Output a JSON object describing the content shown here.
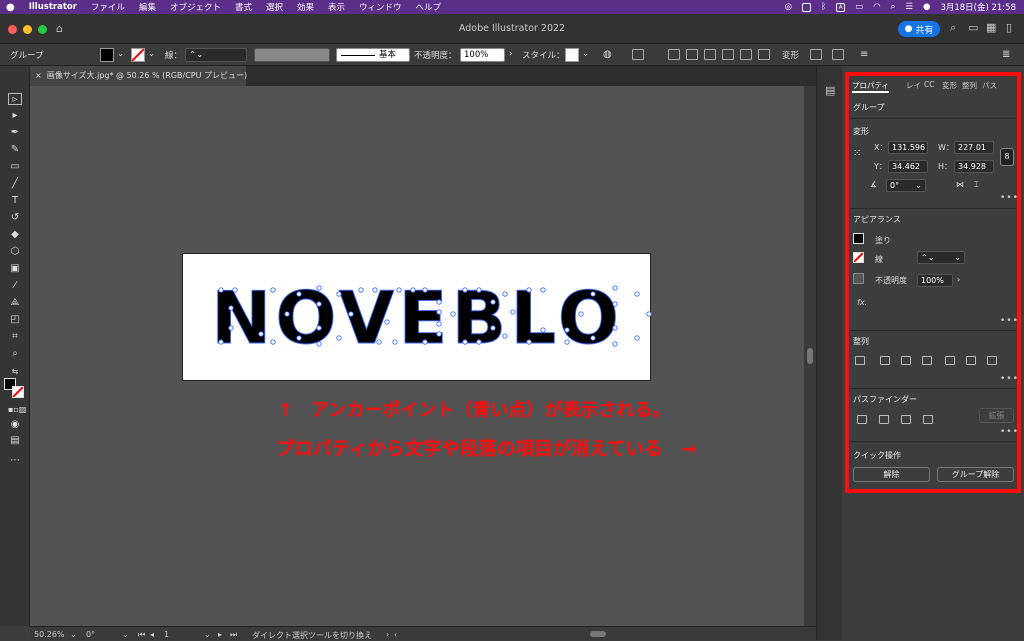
{
  "menubar": {
    "apple": "",
    "items": [
      "Illustrator",
      "ファイル",
      "編集",
      "オブジェクト",
      "書式",
      "選択",
      "効果",
      "表示",
      "ウィンドウ",
      "ヘルプ"
    ],
    "clock": "3月18日(金) 21:58",
    "a_label": "A"
  },
  "window": {
    "title": "Adobe Illustrator 2022",
    "share_label": "共有"
  },
  "control_bar": {
    "selection_type": "グループ",
    "stroke_label": "線：",
    "brush_label": "基本",
    "opacity_label": "不透明度：",
    "opacity_value": "100%",
    "style_label": "スタイル：",
    "transform_label": "変形"
  },
  "document_tab": {
    "close": "×",
    "title": "画像サイズ大.jpg* @ 50.26 % (RGB/CPU プレビュー)"
  },
  "artboard": {
    "text": "NOVEBLO"
  },
  "annotations": {
    "line1": "↑　アンカーポイント（青い点）が表示される。",
    "line2": "プロパティから文字や段落の項目が消えている　→"
  },
  "status_bar": {
    "zoom": "50.26%",
    "rotation": "0°",
    "artboard_number": "1",
    "tool_hint": "ダイレクト選択ツールを切り換え"
  },
  "properties_panel": {
    "tabs": [
      "プロパティ",
      "レイ",
      "CC",
      "変形",
      "整列",
      "パス"
    ],
    "selection_type": "グループ",
    "transform": {
      "heading": "変形",
      "x_label": "X：",
      "x_value": "131.596",
      "y_label": "Y：",
      "y_value": "34.462",
      "w_label": "W：",
      "w_value": "227.01",
      "h_label": "H：",
      "h_value": "34.928",
      "rotate_value": "0°"
    },
    "appearance": {
      "heading": "アピアランス",
      "fill_label": "塗り",
      "stroke_label": "線",
      "opacity_label": "不透明度",
      "opacity_value": "100%",
      "fx_label": "fx."
    },
    "align": {
      "heading": "整列"
    },
    "pathfinder": {
      "heading": "パスファインダー",
      "expand_label": "拡張"
    },
    "quick_actions": {
      "heading": "クイック操作",
      "ungroup_label": "解除",
      "group_ungroup_label": "グループ解除"
    }
  },
  "colors": {
    "menubar": "#5b2e89",
    "accent": "#1473e6",
    "anchor": "#3d6cff",
    "annotation": "#ff0d0d"
  }
}
